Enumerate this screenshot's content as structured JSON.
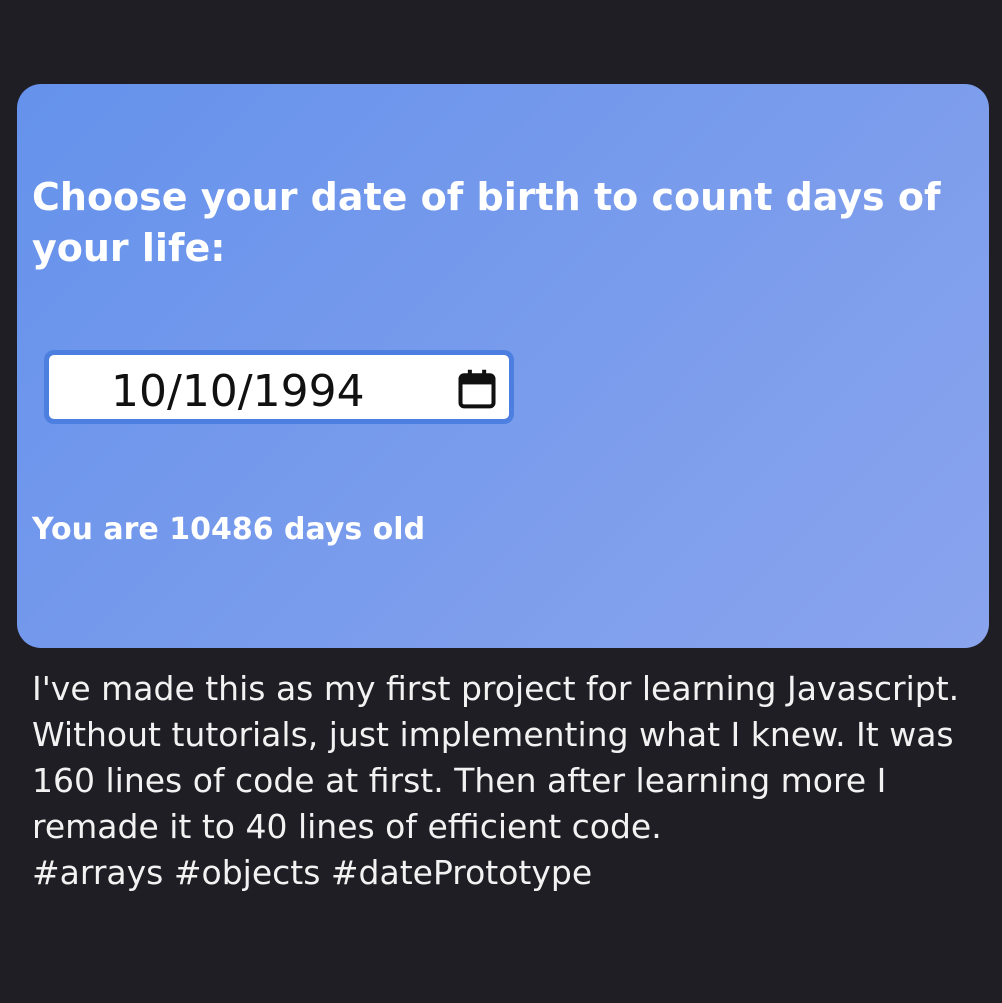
{
  "card": {
    "title": "Choose your date of birth to count days of your life:",
    "date_input": {
      "value": "10/10/1994",
      "icon": "calendar-icon"
    },
    "result_text": "You are 10486 days old"
  },
  "description": {
    "body": "I've made this as my first project for learning Javascript. Without tutorials, just implementing what I knew. It was 160 lines of code at first. Then after learning more I remade it to 40 lines of efficient code.",
    "tags": "#arrays #objects #datePrototype"
  },
  "colors": {
    "background": "#1e1e24",
    "card_gradient_start": "#6592ec",
    "card_gradient_end": "#8aa4ee",
    "input_border": "#4d7fe0",
    "text_light": "#ffffff"
  }
}
